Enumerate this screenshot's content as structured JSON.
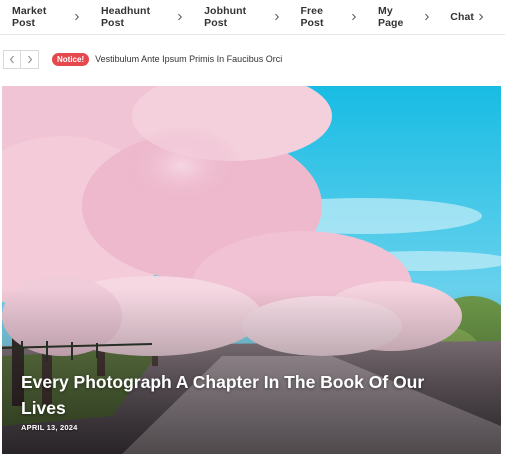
{
  "nav": {
    "items": [
      {
        "label": "Market Post"
      },
      {
        "label": "Headhunt Post"
      },
      {
        "label": "Jobhunt Post"
      },
      {
        "label": "Free Post"
      },
      {
        "label": "My Page"
      },
      {
        "label": "Chat"
      }
    ]
  },
  "ticker": {
    "badge": "Notice!",
    "text": "Vestibulum Ante Ipsum Primis In Faucibus Orci"
  },
  "hero": {
    "title": "Every Photograph A Chapter In The Book Of Our Lives",
    "date": "APRIL 13, 2024"
  },
  "colors": {
    "notice_badge": "#e5484d",
    "nav_text": "#333333",
    "sky": "#2ec3e6",
    "blossom": "#f2b8cd"
  }
}
